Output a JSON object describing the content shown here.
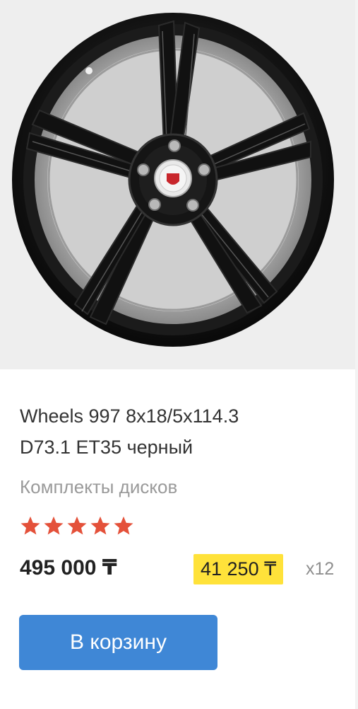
{
  "product": {
    "title": "Wheels 997 8x18/5x114.3\nD73.1 ET35 черный",
    "category": "Комплекты дисков",
    "rating": 5,
    "rating_max": 5,
    "price": "495 000 ₸",
    "installment_price": "41 250 ₸",
    "installment_months": "x12",
    "image_icon": "black-alloy-wheel-photo"
  },
  "actions": {
    "add_to_cart_label": "В корзину"
  },
  "colors": {
    "star": "#e4513a",
    "installment_badge": "#ffe23a",
    "button": "#3f87d6",
    "text_muted": "#9a9a9a"
  }
}
